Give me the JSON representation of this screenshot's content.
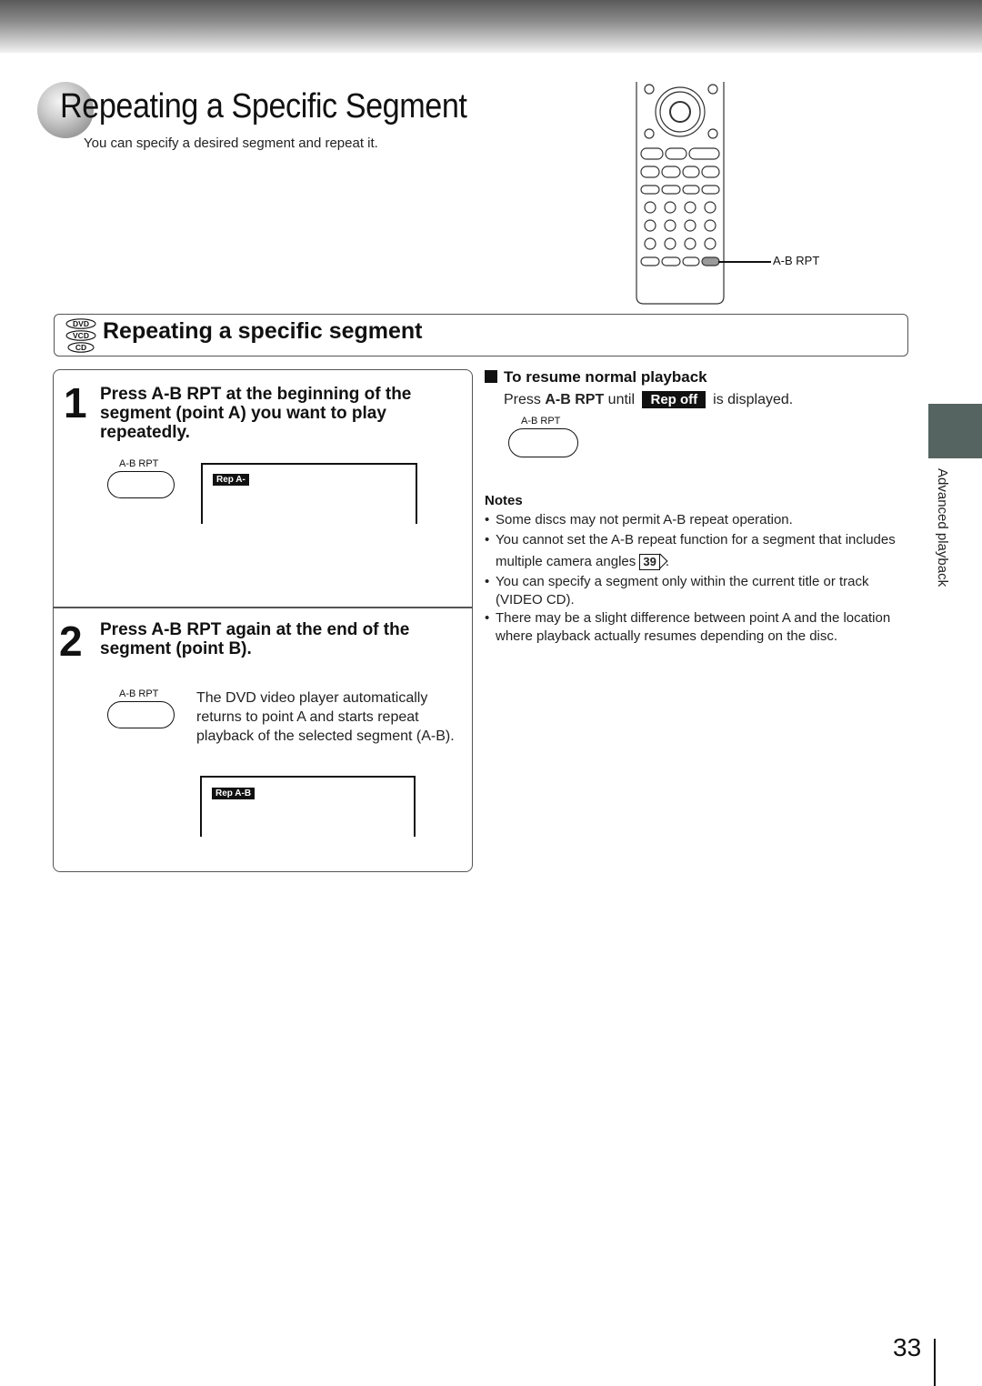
{
  "header": {
    "title": "Repeating a Specific Segment",
    "subtitle": "You can specify a desired segment and repeat it."
  },
  "remote": {
    "callout_label": "A-B RPT",
    "highlight_color": "#9a9a9a"
  },
  "section": {
    "disc_badges": [
      "DVD",
      "VCD",
      "CD"
    ],
    "title": "Repeating a specific segment"
  },
  "steps": [
    {
      "number": "1",
      "text": "Press A-B RPT at the beginning of the segment (point A) you want to play repeatedly.",
      "button_label": "A-B RPT",
      "osd": "Rep A-"
    },
    {
      "number": "2",
      "text": "Press A-B RPT again at the end of the segment (point B).",
      "button_label": "A-B RPT",
      "description": "The DVD video player automatically returns to point A and starts repeat playback of the selected segment (A-B).",
      "osd": "Rep A-B"
    }
  ],
  "resume": {
    "heading": "To resume normal playback",
    "line_prefix": "Press ",
    "line_button": "A-B RPT",
    "line_middle": " until ",
    "osd": "Rep off",
    "line_suffix": "is displayed.",
    "button_label": "A-B RPT"
  },
  "notes": {
    "heading": "Notes",
    "items": [
      "Some discs may not permit A-B repeat operation.",
      "You cannot set the A-B repeat function for a segment that includes multiple camera angles",
      "You can specify a segment only within the current title or track (VIDEO CD).",
      "There may be a slight difference between point A and the location where playback actually resumes depending on the disc."
    ],
    "page_ref": "39",
    "page_ref_suffix": "."
  },
  "side_tab": {
    "label": "Advanced playback",
    "color": "#566461"
  },
  "footer": {
    "page_number": "33"
  }
}
